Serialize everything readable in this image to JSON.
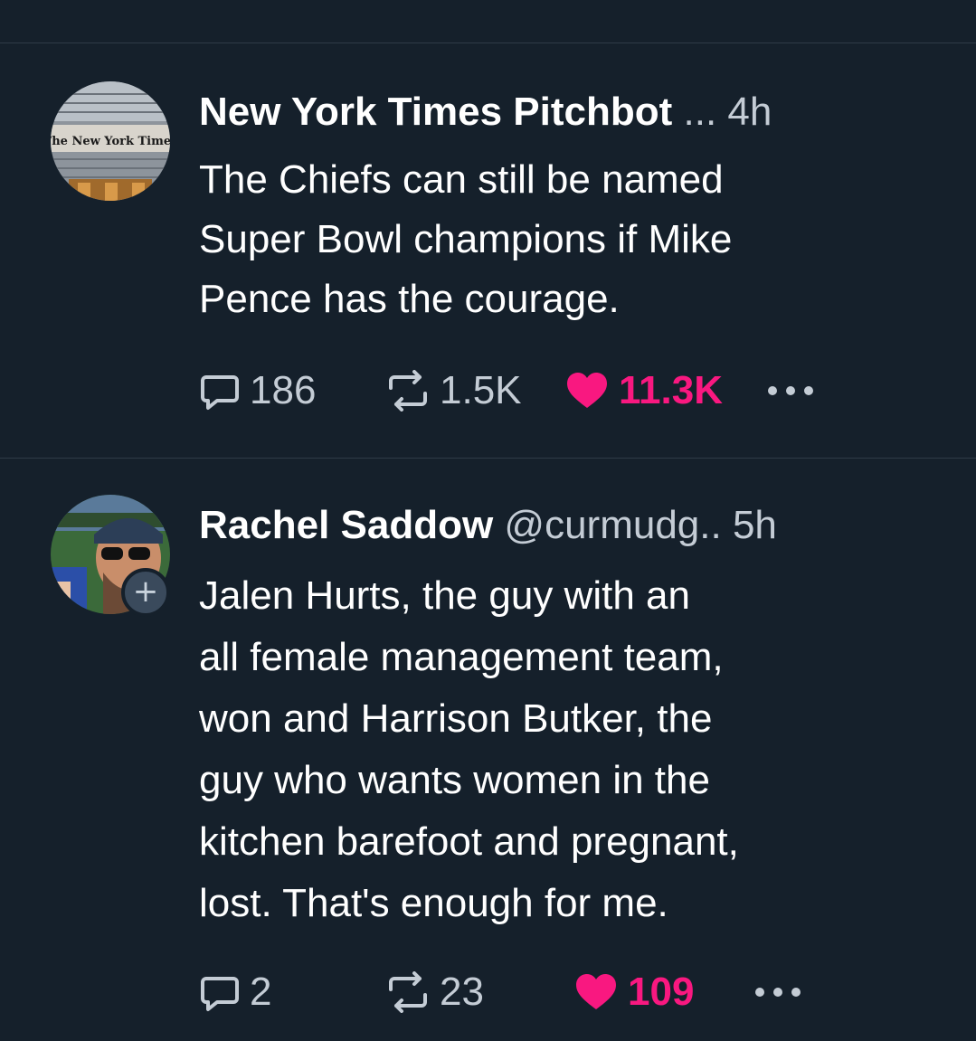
{
  "posts": [
    {
      "author_name": "New York Times Pitchbot",
      "meta": "... 4h",
      "avatar_text": "The New York Times",
      "body_lines": [
        "The Chiefs can still be named",
        "Super Bowl champions if Mike",
        "Pence has the courage."
      ],
      "replies": "186",
      "reposts": "1.5K",
      "likes": "11.3K",
      "liked": true
    },
    {
      "author_name": "Rachel Saddow",
      "meta": "@curmudg.. 5h",
      "follow_symbol": "+",
      "body_lines": [
        "Jalen Hurts, the guy with an",
        "all female management team,",
        "won and Harrison Butker, the",
        "guy who wants women in the",
        "kitchen barefoot and pregnant,",
        "lost. That's enough for me."
      ],
      "replies": "2",
      "reposts": "23",
      "likes": "109",
      "liked": true
    }
  ],
  "colors": {
    "background": "#15202b",
    "divider": "#2f3b47",
    "muted": "#c4ccd5",
    "like": "#f91880"
  },
  "icons": [
    "reply-icon",
    "repost-icon",
    "heart-icon",
    "more-icon",
    "follow-plus-icon"
  ]
}
